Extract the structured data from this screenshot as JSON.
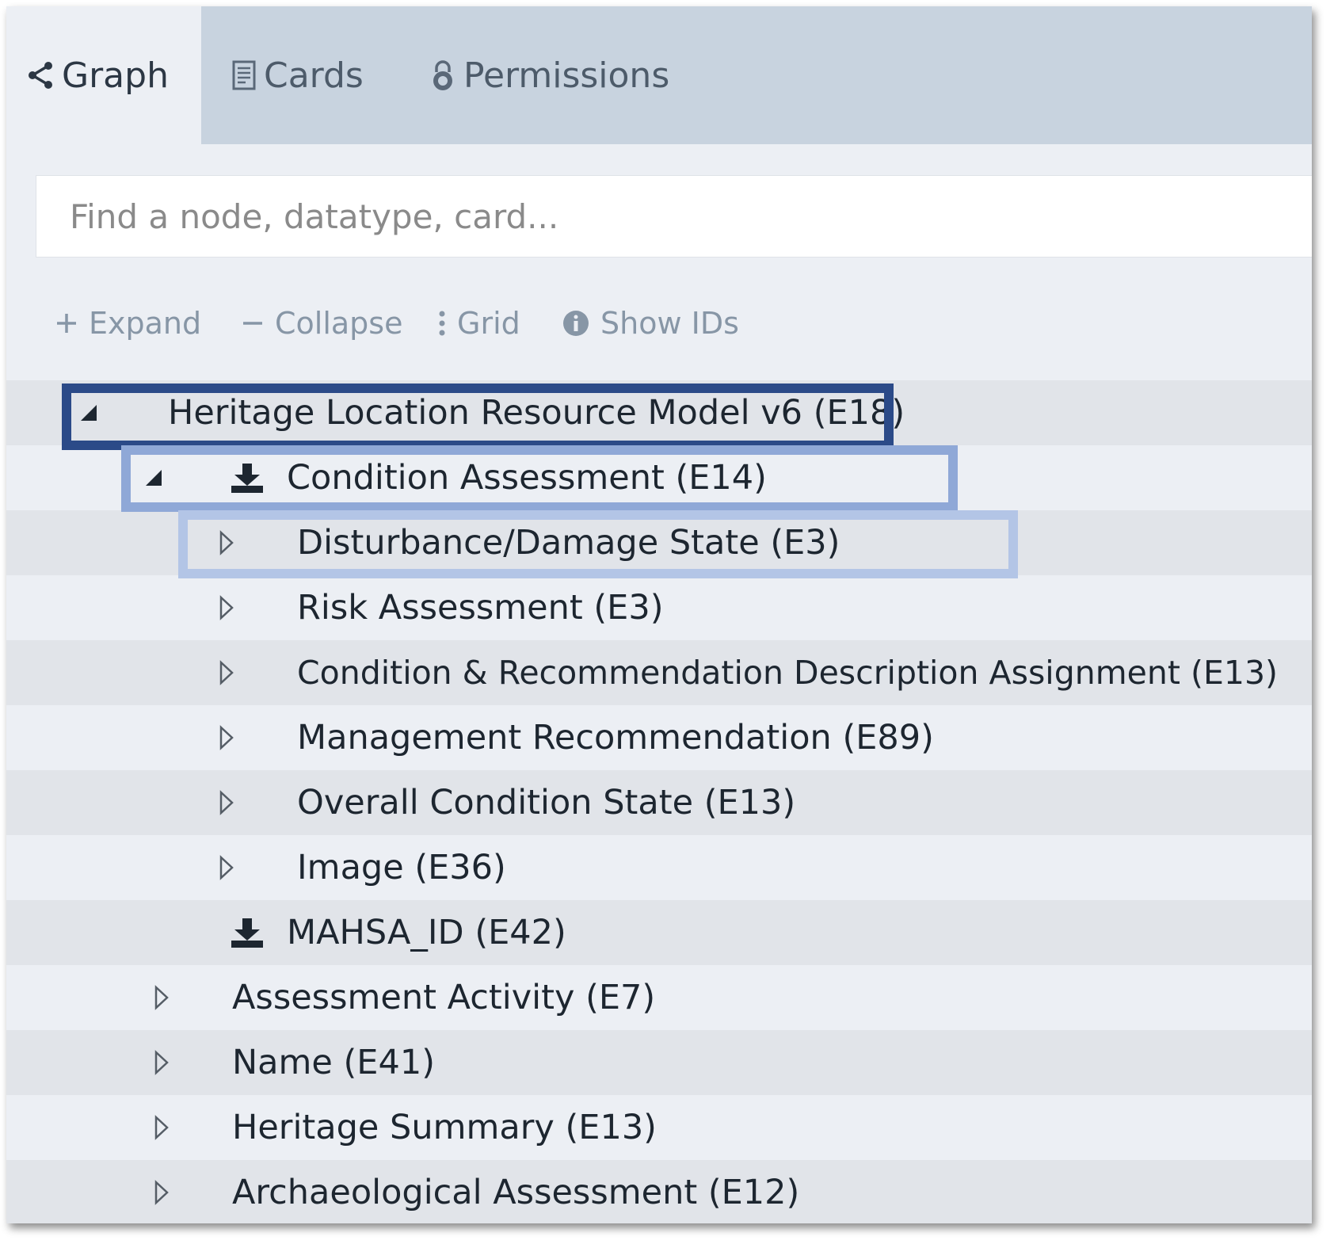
{
  "tabs": {
    "graph": {
      "label": "Graph",
      "icon": "share-icon",
      "active": true
    },
    "cards": {
      "label": "Cards",
      "icon": "document-icon"
    },
    "permissions": {
      "label": "Permissions",
      "icon": "lock-icon"
    }
  },
  "search": {
    "placeholder": "Find a node, datatype, card..."
  },
  "toolbar": {
    "expand": "Expand",
    "collapse": "Collapse",
    "grid": "Grid",
    "show_ids": "Show IDs"
  },
  "tree": {
    "rows": [
      {
        "label": "Heritage Location Resource Model v6 (E18)",
        "toggle": "expanded"
      },
      {
        "label": "Condition Assessment (E14)",
        "toggle": "expanded",
        "icon": "download-icon"
      },
      {
        "label": "Disturbance/Damage State (E3)",
        "toggle": "collapsed"
      },
      {
        "label": "Risk Assessment (E3)",
        "toggle": "collapsed"
      },
      {
        "label": "Condition & Recommendation Description Assignment (E13)",
        "toggle": "collapsed"
      },
      {
        "label": "Management Recommendation (E89)",
        "toggle": "collapsed"
      },
      {
        "label": "Overall Condition State (E13)",
        "toggle": "collapsed"
      },
      {
        "label": "Image (E36)",
        "toggle": "collapsed"
      },
      {
        "label": "MAHSA_ID (E42)",
        "toggle": "none",
        "icon": "download-icon"
      },
      {
        "label": "Assessment Activity (E7)",
        "toggle": "collapsed"
      },
      {
        "label": "Name (E41)",
        "toggle": "collapsed"
      },
      {
        "label": "Heritage Summary (E13)",
        "toggle": "collapsed"
      },
      {
        "label": "Archaeological Assessment (E12)",
        "toggle": "collapsed"
      }
    ]
  },
  "colors": {
    "tabbar_bg": "#c8d3df",
    "panel_bg": "#eceff4",
    "row_alt_bg": "#e1e4e9",
    "highlight_dark": "#2b4a88",
    "highlight_mid": "#8fa8d7",
    "highlight_light": "#b3c5e6"
  }
}
